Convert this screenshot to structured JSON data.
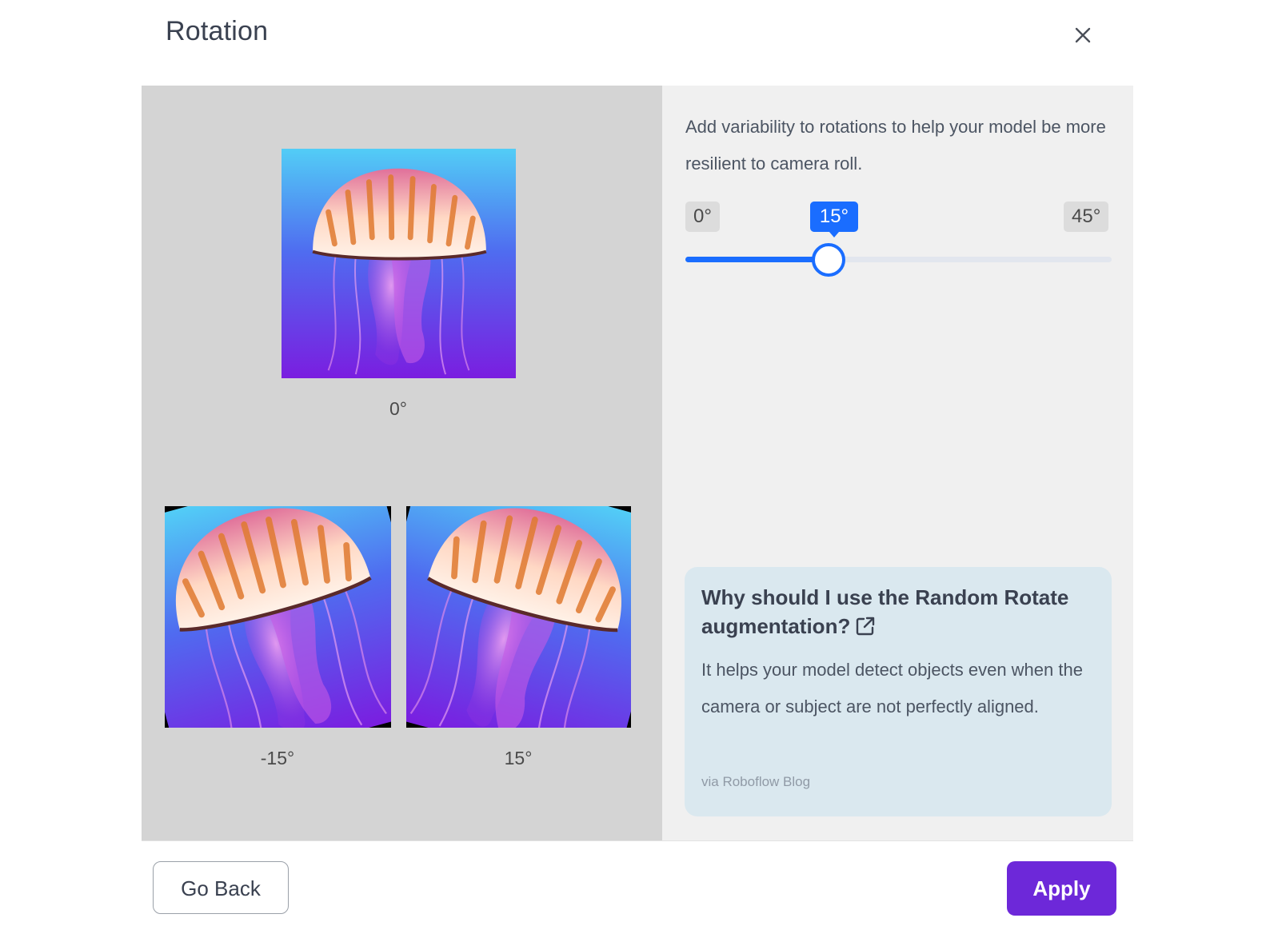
{
  "dialog": {
    "title": "Rotation",
    "close_icon": "close-icon"
  },
  "preview": {
    "images": [
      {
        "label": "0°",
        "rotation": 0
      },
      {
        "label": "-15°",
        "rotation": -15
      },
      {
        "label": "15°",
        "rotation": 15
      }
    ]
  },
  "settings": {
    "description": "Add variability to rotations to help your model be more resilient to camera roll.",
    "slider": {
      "min_label": "0°",
      "max_label": "45°",
      "value_label": "15°",
      "min": 0,
      "max": 45,
      "value": 15,
      "color": "#1a6dff"
    }
  },
  "info": {
    "title": "Why should I use the Random Rotate augmentation?",
    "link_icon": "external-link-icon",
    "text": "It helps your model detect objects even when the camera or subject are not perfectly aligned.",
    "source": "via Roboflow Blog"
  },
  "footer": {
    "back_label": "Go Back",
    "apply_label": "Apply",
    "apply_color": "#6d28d9"
  }
}
